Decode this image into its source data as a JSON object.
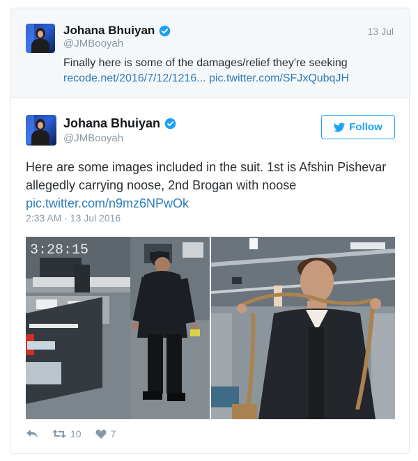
{
  "parent_tweet": {
    "display_name": "Johana Bhuiyan",
    "handle": "@JMBooyah",
    "date": "13 Jul",
    "text": "Finally here is some of the damages/relief they're seeking",
    "link_1": "recode.net/2016/7/12/1216...",
    "link_2": "pic.twitter.com/SFJxQubqJH"
  },
  "main_tweet": {
    "display_name": "Johana Bhuiyan",
    "handle": "@JMBooyah",
    "follow_label": "Follow",
    "text": "Here are some images included in the suit. 1st is Afshin Pishevar allegedly carrying noose, 2nd Brogan with noose",
    "link": "pic.twitter.com/n9mz6NPwOk",
    "timestamp": "2:33 AM - 13 Jul 2016",
    "cctv_time": "3:28:15",
    "retweet_count": "10",
    "like_count": "7"
  },
  "colors": {
    "twitter_blue": "#1da1f2",
    "link_blue": "#2b7bb9",
    "muted_gray": "#8899a6"
  },
  "icons": [
    "verified-badge-icon",
    "twitter-bird-icon",
    "reply-icon",
    "retweet-icon",
    "heart-icon"
  ]
}
